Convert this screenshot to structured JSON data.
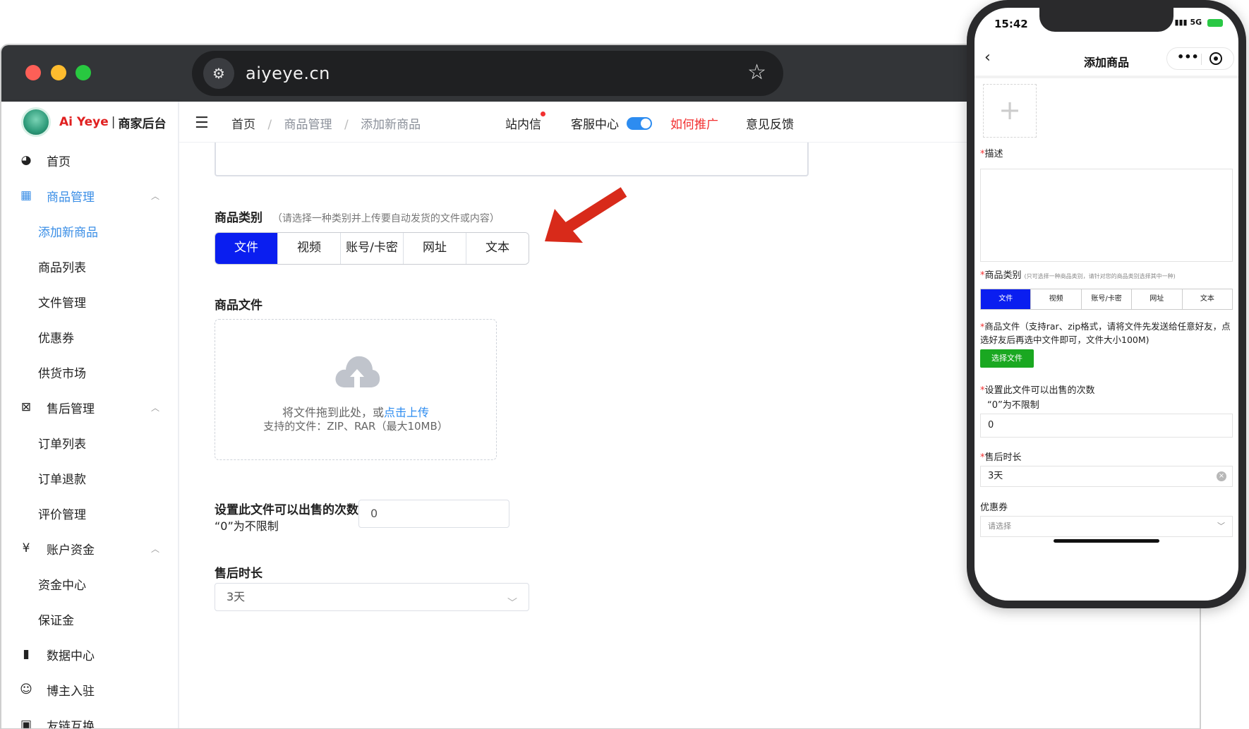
{
  "browser": {
    "url": "aiyeye.cn"
  },
  "brand": {
    "name": "Ai Yeye",
    "separator": "|",
    "subtitle": "商家后台"
  },
  "sidebar": {
    "items": [
      {
        "label": "首页",
        "icon": "dashboard-icon"
      },
      {
        "label": "商品管理",
        "icon": "grid-icon"
      },
      {
        "label": "添加新商品"
      },
      {
        "label": "商品列表"
      },
      {
        "label": "文件管理"
      },
      {
        "label": "优惠券"
      },
      {
        "label": "供货市场"
      },
      {
        "label": "售后管理",
        "icon": "aftersale-icon"
      },
      {
        "label": "订单列表"
      },
      {
        "label": "订单退款"
      },
      {
        "label": "评价管理"
      },
      {
        "label": "账户资金",
        "icon": "yen-icon"
      },
      {
        "label": "资金中心"
      },
      {
        "label": "保证金"
      },
      {
        "label": "数据中心",
        "icon": "bar-chart-icon"
      },
      {
        "label": "博主入驻",
        "icon": "blogger-icon"
      },
      {
        "label": "友链互换",
        "icon": "link-icon"
      }
    ]
  },
  "header": {
    "breadcrumb": [
      "首页",
      "商品管理",
      "添加新商品"
    ],
    "breadcrumb_sep": "/",
    "inbox": "站内信",
    "service": "客服中心",
    "promo": "如何推广",
    "feedback": "意见反馈"
  },
  "form": {
    "category_label": "商品类别",
    "category_hint": "（请选择一种类别并上传要自动发货的文件或内容）",
    "categories": [
      "文件",
      "视频",
      "账号/卡密",
      "网址",
      "文本"
    ],
    "selected_category": "文件",
    "file_label": "商品文件",
    "upload_text": "将文件拖到此处，或",
    "upload_link": "点击上传",
    "upload_support": "支持的文件：ZIP、RAR（最大10MB）",
    "sell_count_label": "设置此文件可以出售的次数",
    "sell_count_note": "“0”为不限制",
    "sell_count_value": "0",
    "aftersale_label": "售后时长",
    "aftersale_value": "3天"
  },
  "phone": {
    "time": "15:42",
    "signal": "5G",
    "title": "添加商品",
    "add_image": "+",
    "desc_label": "描述",
    "required_mark": "*",
    "category_label": "商品类别",
    "category_hint": "(只可选择一种商品类别，请针对您的商品类别选择其中一种)",
    "categories": [
      "文件",
      "视频",
      "账号/卡密",
      "网址",
      "文本"
    ],
    "file_desc": "商品文件（支持rar、zip格式，请将文件先发送给任意好友，点选好友后再选中文件即可，文件大小100M)",
    "choose_file": "选择文件",
    "sell_count_label": "设置此文件可以出售的次数",
    "sell_count_note": "“0”为不限制",
    "sell_count_value": "0",
    "aftersale_label": "售后时长",
    "aftersale_value": "3天",
    "coupon_label": "优惠券",
    "coupon_placeholder": "请选择"
  },
  "colors": {
    "accent": "#0a1ef0",
    "link": "#2d8cf0",
    "danger": "#f23030",
    "green": "#1aa821"
  }
}
